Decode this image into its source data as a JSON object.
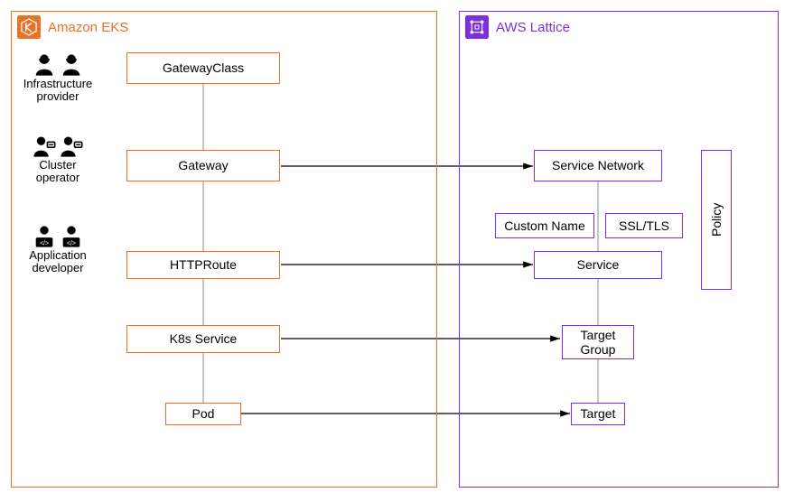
{
  "eks": {
    "title": "Amazon EKS",
    "color": "#EA7125",
    "nodes": {
      "gatewayclass": "GatewayClass",
      "gateway": "Gateway",
      "httproute": "HTTPRoute",
      "k8s_service": "K8s Service",
      "pod": "Pod"
    }
  },
  "lattice": {
    "title": "AWS Lattice",
    "color": "#7B2FE0",
    "nodes": {
      "service_network": "Service Network",
      "custom_name": "Custom Name",
      "ssl_tls": "SSL/TLS",
      "service": "Service",
      "target_group": "Target\nGroup",
      "target": "Target",
      "policy": "Policy"
    }
  },
  "roles": {
    "infra": "Infrastructure\nprovider",
    "cluster": "Cluster\noperator",
    "appdev": "Application\ndeveloper"
  },
  "chart_data": {
    "type": "diagram",
    "description": "Mapping between Kubernetes Gateway API resources in Amazon EKS and AWS Lattice constructs",
    "eks_left_roles": [
      {
        "role": "Infrastructure provider",
        "near": "GatewayClass"
      },
      {
        "role": "Cluster operator",
        "near": "Gateway"
      },
      {
        "role": "Application developer",
        "near": "HTTPRoute"
      }
    ],
    "eks_chain": [
      "GatewayClass",
      "Gateway",
      "HTTPRoute",
      "K8s Service",
      "Pod"
    ],
    "lattice_chain": [
      "Service Network",
      "Service",
      "Target Group",
      "Target"
    ],
    "lattice_service_aux": [
      "Custom Name",
      "SSL/TLS"
    ],
    "lattice_policy_spans": [
      "Service Network",
      "Service"
    ],
    "cross_mappings": [
      {
        "from_eks": "Gateway",
        "to_lattice": "Service Network"
      },
      {
        "from_eks": "HTTPRoute",
        "to_lattice": "Service"
      },
      {
        "from_eks": "K8s Service",
        "to_lattice": "Target Group"
      },
      {
        "from_eks": "Pod",
        "to_lattice": "Target"
      }
    ]
  }
}
